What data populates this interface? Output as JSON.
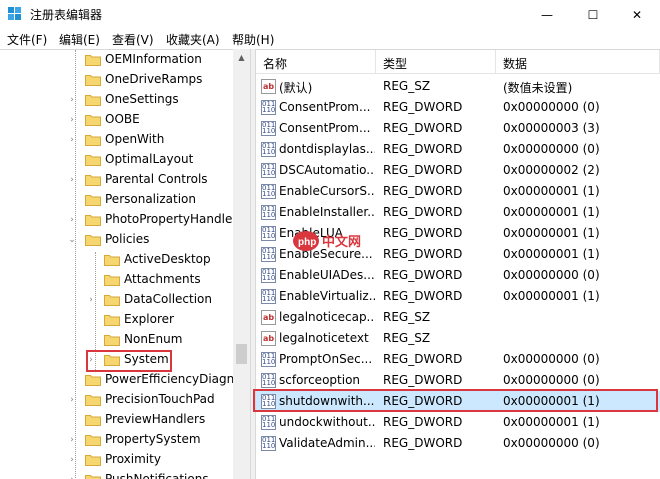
{
  "window": {
    "title": "注册表编辑器",
    "controls": {
      "minimize": "—",
      "maximize": "☐",
      "close": "✕"
    }
  },
  "menu": [
    "文件(F)",
    "编辑(E)",
    "查看(V)",
    "收藏夹(A)",
    "帮助(H)"
  ],
  "tree": {
    "items": [
      {
        "label": "OEMInformation",
        "expander": ""
      },
      {
        "label": "OneDriveRamps",
        "expander": ""
      },
      {
        "label": "OneSettings",
        "expander": "›"
      },
      {
        "label": "OOBE",
        "expander": "›"
      },
      {
        "label": "OpenWith",
        "expander": "›"
      },
      {
        "label": "OptimalLayout",
        "expander": ""
      },
      {
        "label": "Parental Controls",
        "expander": "›"
      },
      {
        "label": "Personalization",
        "expander": ""
      },
      {
        "label": "PhotoPropertyHandler",
        "expander": "›"
      },
      {
        "label": "Policies",
        "expander": "⌄"
      },
      {
        "label": "ActiveDesktop",
        "expander": ""
      },
      {
        "label": "Attachments",
        "expander": ""
      },
      {
        "label": "DataCollection",
        "expander": "›"
      },
      {
        "label": "Explorer",
        "expander": ""
      },
      {
        "label": "NonEnum",
        "expander": ""
      },
      {
        "label": "System",
        "expander": "›"
      },
      {
        "label": "PowerEfficiencyDiagnostics",
        "expander": ""
      },
      {
        "label": "PrecisionTouchPad",
        "expander": "›"
      },
      {
        "label": "PreviewHandlers",
        "expander": ""
      },
      {
        "label": "PropertySystem",
        "expander": "›"
      },
      {
        "label": "Proximity",
        "expander": "›"
      },
      {
        "label": "PushNotifications",
        "expander": "›"
      }
    ]
  },
  "list": {
    "headers": {
      "name": "名称",
      "type": "类型",
      "data": "数据"
    },
    "rows": [
      {
        "icon": "ab",
        "name": "(默认)",
        "type": "REG_SZ",
        "data": "(数值未设置)"
      },
      {
        "icon": "dword",
        "name": "ConsentProm...",
        "type": "REG_DWORD",
        "data": "0x00000000 (0)"
      },
      {
        "icon": "dword",
        "name": "ConsentProm...",
        "type": "REG_DWORD",
        "data": "0x00000003 (3)"
      },
      {
        "icon": "dword",
        "name": "dontdisplaylas...",
        "type": "REG_DWORD",
        "data": "0x00000000 (0)"
      },
      {
        "icon": "dword",
        "name": "DSCAutomatio...",
        "type": "REG_DWORD",
        "data": "0x00000002 (2)"
      },
      {
        "icon": "dword",
        "name": "EnableCursorS...",
        "type": "REG_DWORD",
        "data": "0x00000001 (1)"
      },
      {
        "icon": "dword",
        "name": "EnableInstaller...",
        "type": "REG_DWORD",
        "data": "0x00000001 (1)"
      },
      {
        "icon": "dword",
        "name": "EnableLUA",
        "type": "REG_DWORD",
        "data": "0x00000001 (1)"
      },
      {
        "icon": "dword",
        "name": "EnableSecure...",
        "type": "REG_DWORD",
        "data": "0x00000001 (1)"
      },
      {
        "icon": "dword",
        "name": "EnableUIADes...",
        "type": "REG_DWORD",
        "data": "0x00000000 (0)"
      },
      {
        "icon": "dword",
        "name": "EnableVirtualiz...",
        "type": "REG_DWORD",
        "data": "0x00000001 (1)"
      },
      {
        "icon": "ab",
        "name": "legalnoticecap...",
        "type": "REG_SZ",
        "data": ""
      },
      {
        "icon": "ab",
        "name": "legalnoticetext",
        "type": "REG_SZ",
        "data": ""
      },
      {
        "icon": "dword",
        "name": "PromptOnSec...",
        "type": "REG_DWORD",
        "data": "0x00000000 (0)"
      },
      {
        "icon": "dword",
        "name": "scforceoption",
        "type": "REG_DWORD",
        "data": "0x00000000 (0)"
      },
      {
        "icon": "dword",
        "name": "shutdownwith...",
        "type": "REG_DWORD",
        "data": "0x00000001 (1)"
      },
      {
        "icon": "dword",
        "name": "undockwithout...",
        "type": "REG_DWORD",
        "data": "0x00000001 (1)"
      },
      {
        "icon": "dword",
        "name": "ValidateAdmin...",
        "type": "REG_DWORD",
        "data": "0x00000000 (0)"
      }
    ]
  },
  "watermark": "php中文网",
  "colors": {
    "selection": "#cce8ff",
    "highlight_box": "#d9363e",
    "folder": "#f6d66e"
  }
}
